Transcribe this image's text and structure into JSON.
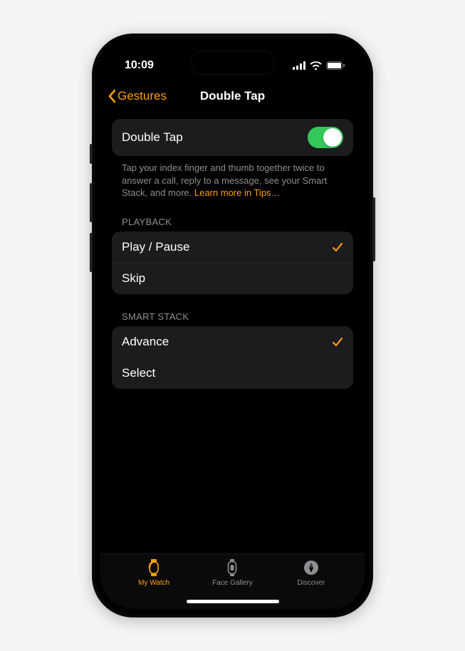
{
  "statusbar": {
    "time": "10:09"
  },
  "nav": {
    "back_label": "Gestures",
    "title": "Double Tap"
  },
  "main_switch": {
    "label": "Double Tap",
    "on": true
  },
  "description": {
    "text": "Tap your index finger and thumb together twice to answer a call, reply to a message, see your Smart Stack, and more. ",
    "link": "Learn more in Tips…"
  },
  "sections": [
    {
      "header": "PLAYBACK",
      "rows": [
        {
          "label": "Play / Pause",
          "selected": true
        },
        {
          "label": "Skip",
          "selected": false
        }
      ]
    },
    {
      "header": "SMART STACK",
      "rows": [
        {
          "label": "Advance",
          "selected": true
        },
        {
          "label": "Select",
          "selected": false
        }
      ]
    }
  ],
  "tabs": [
    {
      "label": "My Watch",
      "active": true
    },
    {
      "label": "Face Gallery",
      "active": false
    },
    {
      "label": "Discover",
      "active": false
    }
  ],
  "colors": {
    "accent": "#ff9f0a",
    "toggle_on": "#34c759"
  }
}
